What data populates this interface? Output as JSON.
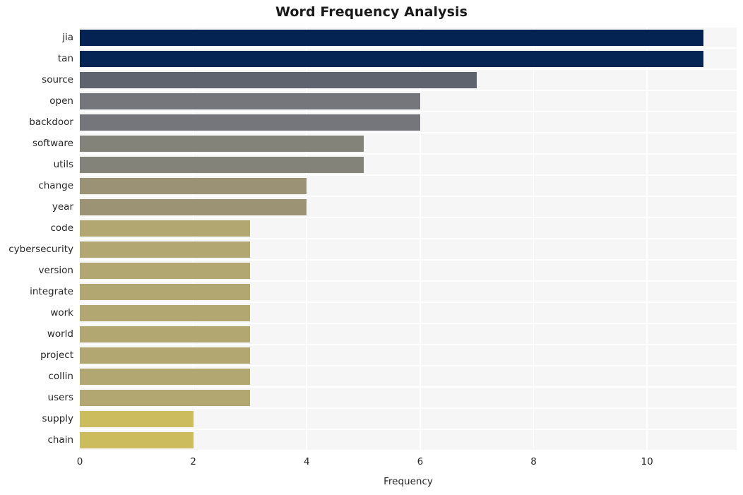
{
  "chart_data": {
    "type": "bar",
    "orientation": "horizontal",
    "title": "Word Frequency Analysis",
    "xlabel": "Frequency",
    "ylabel": "",
    "categories": [
      "jia",
      "tan",
      "source",
      "open",
      "backdoor",
      "software",
      "utils",
      "change",
      "year",
      "code",
      "cybersecurity",
      "version",
      "integrate",
      "work",
      "world",
      "project",
      "collin",
      "users",
      "supply",
      "chain"
    ],
    "values": [
      11,
      11,
      7,
      6,
      6,
      5,
      5,
      4,
      4,
      3,
      3,
      3,
      3,
      3,
      3,
      3,
      3,
      3,
      2,
      2
    ],
    "xlim": [
      0,
      11.58
    ],
    "xticks": [
      0,
      2,
      4,
      6,
      8,
      10
    ],
    "xtick_labels": [
      "0",
      "2",
      "4",
      "6",
      "8",
      "10"
    ],
    "grid": true,
    "grid_color": "#ffffff",
    "plot_background": "#f6f6f6",
    "legend": null,
    "bar_colors": [
      "#042352",
      "#052554",
      "#5f636f",
      "#75767b",
      "#75767b",
      "#84837a",
      "#84837a",
      "#9b9276",
      "#9c9375",
      "#b3a771",
      "#b3a771",
      "#b3a771",
      "#b3a771",
      "#b3a771",
      "#b3a771",
      "#b3a771",
      "#b3a771",
      "#b3a771",
      "#cdbc5e",
      "#cdbc5e"
    ]
  }
}
